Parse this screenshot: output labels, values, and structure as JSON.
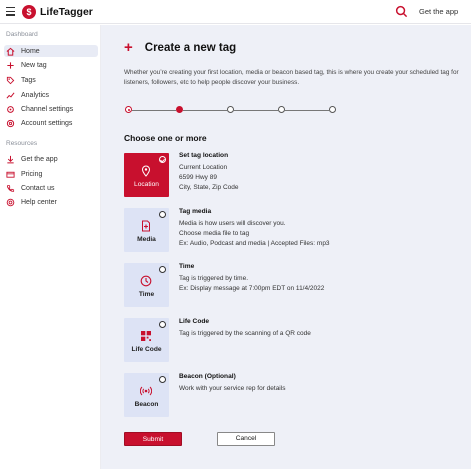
{
  "header": {
    "brand": "LifeTagger",
    "get_app": "Get the app",
    "menu_icon": "hamburger-icon",
    "search_icon": "search-icon"
  },
  "sidebar": {
    "dashboard_label": "Dashboard",
    "dashboard_items": [
      {
        "label": "Home",
        "icon": "home-icon",
        "active": true
      },
      {
        "label": "New tag",
        "icon": "plus-icon",
        "active": false
      },
      {
        "label": "Tags",
        "icon": "tag-icon",
        "active": false
      },
      {
        "label": "Analytics",
        "icon": "analytics-icon",
        "active": false
      },
      {
        "label": "Channel settings",
        "icon": "channel-settings-icon",
        "active": false
      },
      {
        "label": "Account settings",
        "icon": "account-settings-icon",
        "active": false
      }
    ],
    "resources_label": "Resources",
    "resources_items": [
      {
        "label": "Get the app",
        "icon": "download-icon"
      },
      {
        "label": "Pricing",
        "icon": "pricing-icon"
      },
      {
        "label": "Contact us",
        "icon": "phone-icon"
      },
      {
        "label": "Help center",
        "icon": "help-icon"
      }
    ]
  },
  "main": {
    "title": "Create a new tag",
    "intro": "Whether you’re creating your first location, media or beacon based tag, this is where you create your scheduled tag for listeners, followers, etc to help people discover your business.",
    "stepper": {
      "total_steps": 5,
      "current_step": 1
    },
    "choose_heading": "Choose one or more",
    "options": [
      {
        "label": "Location",
        "icon": "location-pin-icon",
        "selected": true,
        "title": "Set tag location",
        "lines": [
          "Current Location",
          "6599 Hwy 89",
          "City, State, Zip Code"
        ]
      },
      {
        "label": "Media",
        "icon": "media-file-icon",
        "selected": false,
        "title": "Tag media",
        "lines": [
          "Media is how users will discover you.",
          "Choose media file to tag",
          "Ex: Audio, Podcast and media | Accepted Files: mp3"
        ]
      },
      {
        "label": "Time",
        "icon": "clock-icon",
        "selected": false,
        "title": "Time",
        "lines": [
          "Tag is triggered by time.",
          "Ex: Display message at 7:00pm EDT on 11/4/2022"
        ]
      },
      {
        "label": "Life Code",
        "icon": "qr-code-icon",
        "selected": false,
        "title": "Life Code",
        "lines": [
          "Tag is triggered by the scanning of a QR code"
        ]
      },
      {
        "label": "Beacon",
        "icon": "beacon-icon",
        "selected": false,
        "title": "Beacon (Optional)",
        "lines": [
          "Work with your service rep for details"
        ]
      }
    ],
    "submit_label": "Submit",
    "cancel_label": "Cancel"
  },
  "colors": {
    "accent": "#c8102e",
    "card_bg": "#dde3f5",
    "main_bg": "#eef0f7",
    "active_nav_bg": "#e8ebf5"
  }
}
